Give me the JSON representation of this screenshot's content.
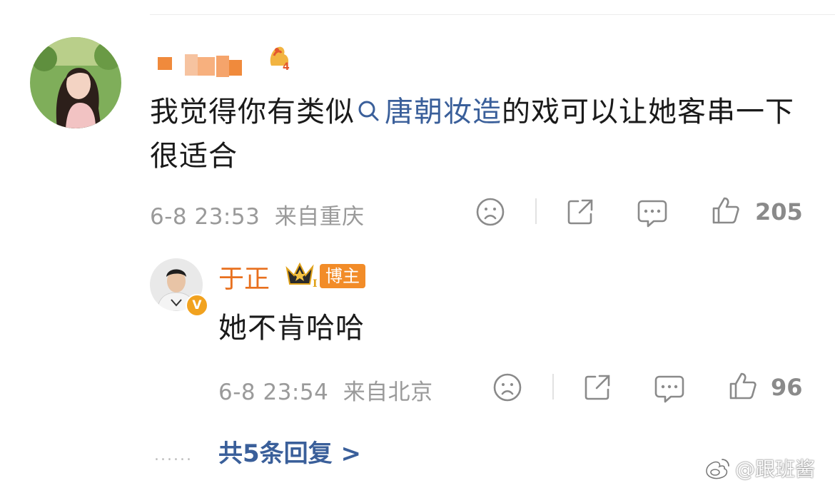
{
  "comment": {
    "text_before": "我觉得你有类似",
    "topic": "唐朝妆造",
    "text_after": "的戏可以让她客串一下很适合",
    "level": "4",
    "time": "6-8 23:53",
    "location": "来自重庆",
    "likes": "205"
  },
  "reply": {
    "author": "于正",
    "tag": "博主",
    "verified_mark": "V",
    "crown_level": "I",
    "text": "她不肯哈哈",
    "time": "6-8 23:54",
    "location": "来自北京",
    "likes": "96"
  },
  "more_replies": "共5条回复 >",
  "dots": "......",
  "watermark": "@跟班酱",
  "colors": {
    "topic_link": "#3a5f9a",
    "author_name": "#e8701e",
    "blogger_tag": "#f28c28",
    "meta_text": "#9a9a9a"
  },
  "icons": [
    "search-icon",
    "sad-face-icon",
    "share-icon",
    "comment-icon",
    "thumbs-up-icon",
    "crown-icon",
    "weibo-logo-icon"
  ]
}
